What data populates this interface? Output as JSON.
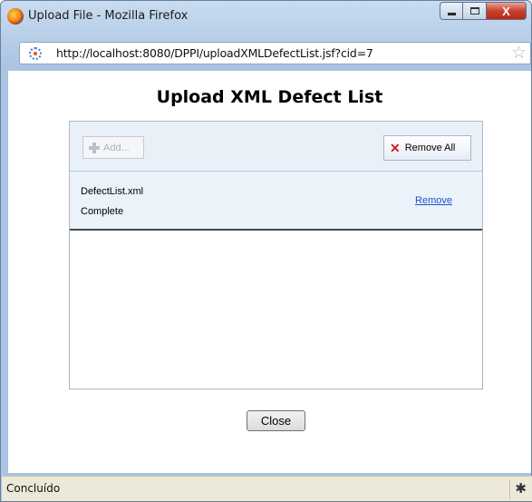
{
  "window": {
    "title": "Upload File - Mozilla Firefox",
    "close_glyph": "X"
  },
  "addressbar": {
    "url": "http://localhost:8080/DPPI/uploadXMLDefectList.jsf?cid=7"
  },
  "page": {
    "title": "Upload XML Defect List"
  },
  "upload": {
    "add_label": "Add...",
    "remove_all_label": "Remove All",
    "files": [
      {
        "name": "DefectList.xml",
        "status": "Complete",
        "remove_label": "Remove"
      }
    ]
  },
  "actions": {
    "close_label": "Close"
  },
  "statusbar": {
    "text": "Concluído"
  },
  "icons": {
    "app": "firefox-icon",
    "loading": "loading-icon",
    "bookmark": "star-icon",
    "add": "plus-icon",
    "remove_all": "x-icon",
    "addon": "addon-bar-icon"
  },
  "colors": {
    "link": "#1a55c9",
    "remove_all_icon": "#d51f1f",
    "panel_header": "#e9f0f8",
    "statusbar": "#ede9d9"
  }
}
